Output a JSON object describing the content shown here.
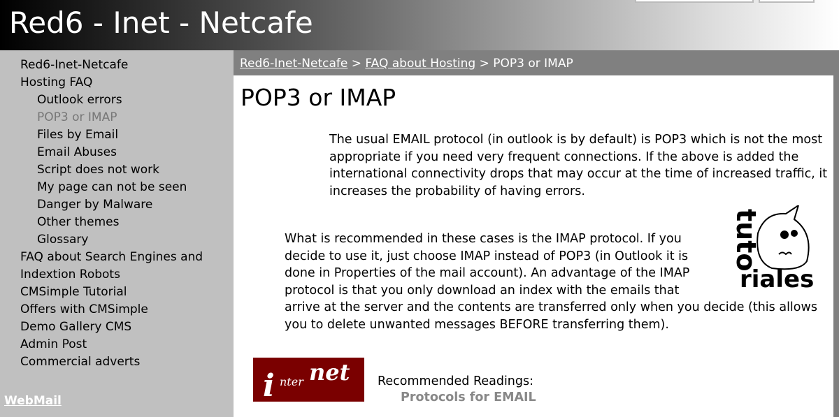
{
  "header": {
    "title": "Red6 - Inet - Netcafe"
  },
  "sidebar": {
    "items": [
      {
        "label": "Red6-Inet-Netcafe",
        "level": "top"
      },
      {
        "label": "Hosting FAQ",
        "level": "top"
      },
      {
        "label": "Outlook errors",
        "level": "sub"
      },
      {
        "label": "POP3 or IMAP",
        "level": "sub",
        "active": true
      },
      {
        "label": "Files by Email",
        "level": "sub"
      },
      {
        "label": "Email Abuses",
        "level": "sub"
      },
      {
        "label": "Script does not work",
        "level": "sub"
      },
      {
        "label": "My page can not be seen",
        "level": "sub"
      },
      {
        "label": "Danger by Malware",
        "level": "sub"
      },
      {
        "label": "Other themes",
        "level": "sub"
      },
      {
        "label": "Glossary",
        "level": "sub"
      },
      {
        "label": "FAQ about Search Engines and",
        "level": "top"
      },
      {
        "label": "Indextion Robots",
        "level": "top"
      },
      {
        "label": "CMSimple Tutorial",
        "level": "top"
      },
      {
        "label": "Offers with CMSimple",
        "level": "top"
      },
      {
        "label": "Demo Gallery CMS",
        "level": "top"
      },
      {
        "label": "Admin Post",
        "level": "top"
      },
      {
        "label": "Commercial adverts",
        "level": "top"
      }
    ],
    "webmail": "WebMail"
  },
  "breadcrumb": {
    "home": "Red6-Inet-Netcafe",
    "sep": ">",
    "section": "FAQ about Hosting",
    "current": "POP3 or IMAP"
  },
  "main": {
    "title": "POP3 or IMAP",
    "para1": "The usual EMAIL protocol (in outlook is by default) is POP3 which is not the most appropriate if you need very frequent connections. If the above is added the international connectivity drops that may occur at the time of increased traffic, it increases the probability of having errors.",
    "para2": "What is recommended in these cases is the IMAP protocol. If you decide to use it, just choose IMAP instead of POP3 (in Outlook it is done in Properties of the mail account). An advantage of the IMAP protocol is that you only download an index with the emails that arrive at the server and the contents are transferred only when you decide (this allows you to delete unwanted messages BEFORE transferring them).",
    "logo_tuto": "tutoriales",
    "logo_internet": "interNet",
    "recommended_label": "Recommended Readings:",
    "recommended_link": "Protocols for EMAIL"
  },
  "colors": {
    "sidebar": "#c0c0c0",
    "breadcrumb_bar": "#808080",
    "internet_logo": "#7a0000"
  }
}
